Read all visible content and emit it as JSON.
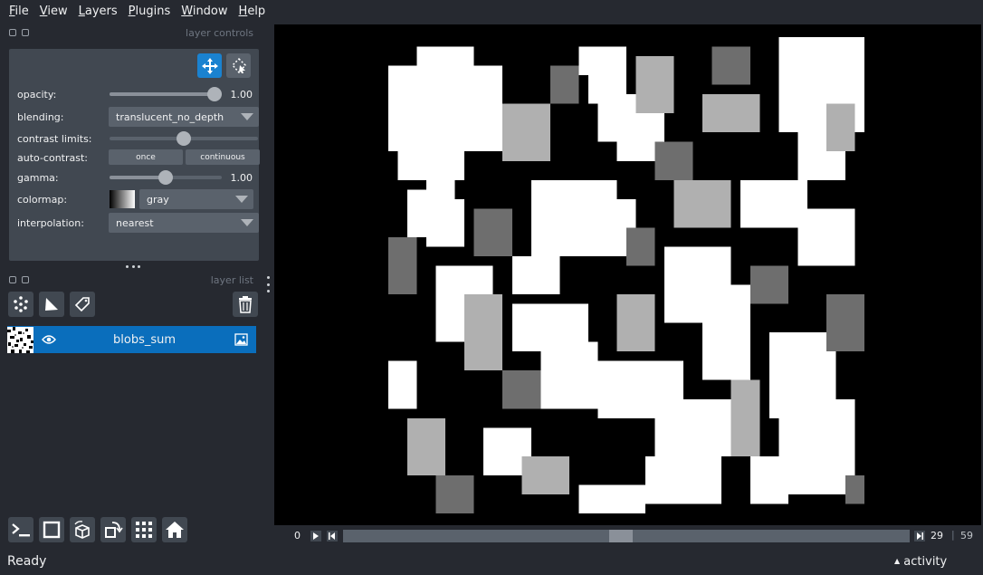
{
  "menubar": {
    "items": [
      {
        "label": "File",
        "mnemonic": "F",
        "rest": "ile"
      },
      {
        "label": "View",
        "mnemonic": "V",
        "rest": "iew"
      },
      {
        "label": "Layers",
        "mnemonic": "L",
        "rest": "ayers"
      },
      {
        "label": "Plugins",
        "mnemonic": "P",
        "rest": "lugins"
      },
      {
        "label": "Window",
        "mnemonic": "W",
        "rest": "indow"
      },
      {
        "label": "Help",
        "mnemonic": "H",
        "rest": "elp"
      }
    ]
  },
  "layer_controls": {
    "title": "layer controls",
    "opacity_label": "opacity:",
    "opacity_value": "1.00",
    "opacity_level": 1.0,
    "blending_label": "blending:",
    "blending_value": "translucent_no_depth",
    "contrast_label": "contrast limits:",
    "contrast_level": 0.5,
    "autocontrast_label": "auto-contrast:",
    "once_label": "once",
    "continuous_label": "continuous",
    "gamma_label": "gamma:",
    "gamma_value": "1.00",
    "gamma_level": 0.5,
    "colormap_label": "colormap:",
    "colormap_value": "gray",
    "interpolation_label": "interpolation:",
    "interpolation_value": "nearest"
  },
  "layer_list": {
    "title": "layer list",
    "layers": [
      {
        "name": "blobs_sum",
        "visible": true,
        "type_icon": "image-icon"
      }
    ]
  },
  "dims": {
    "current": "0",
    "position": "29",
    "max": "59",
    "slider_level": 0.49
  },
  "status": {
    "text": "Ready",
    "activity_label": "activity"
  },
  "colors": {
    "accent": "#0a6ebc",
    "background": "#262930",
    "panel": "#414851"
  }
}
